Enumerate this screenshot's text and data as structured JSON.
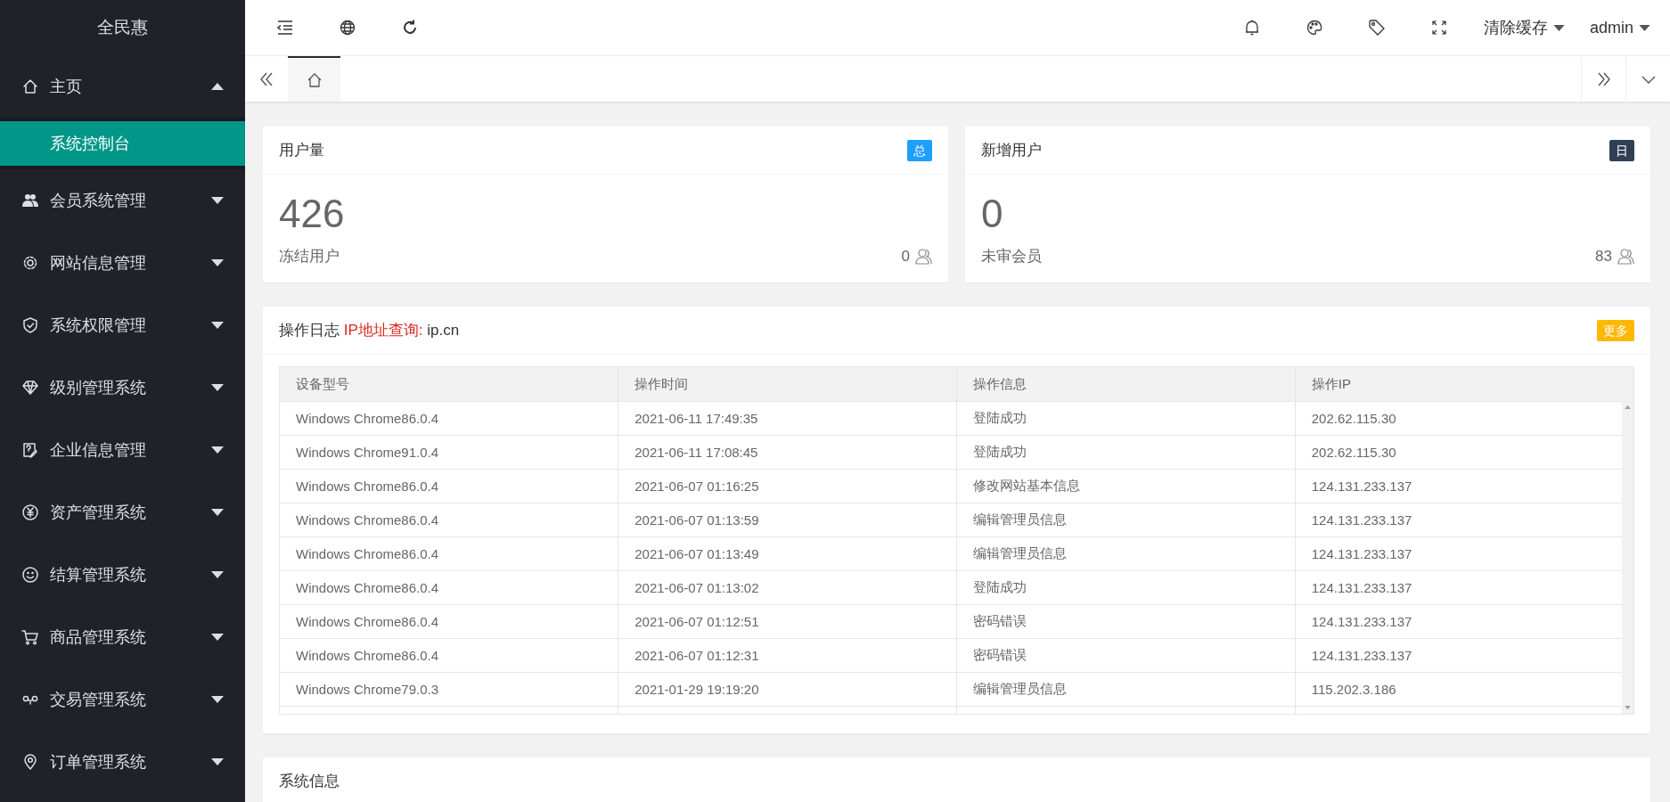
{
  "sidebar": {
    "logo": "全民惠",
    "items": [
      {
        "label": "主页",
        "expanded": true,
        "children": [
          {
            "label": "系统控制台",
            "selected": true
          }
        ]
      },
      {
        "label": "会员系统管理",
        "expanded": false
      },
      {
        "label": "网站信息管理",
        "expanded": false
      },
      {
        "label": "系统权限管理",
        "expanded": false
      },
      {
        "label": "级别管理系统",
        "expanded": false
      },
      {
        "label": "企业信息管理",
        "expanded": false
      },
      {
        "label": "资产管理系统",
        "expanded": false
      },
      {
        "label": "结算管理系统",
        "expanded": false
      },
      {
        "label": "商品管理系统",
        "expanded": false
      },
      {
        "label": "交易管理系统",
        "expanded": false
      },
      {
        "label": "订单管理系统",
        "expanded": false
      }
    ]
  },
  "header": {
    "menus": [
      {
        "label": "清除缓存"
      },
      {
        "label": "admin"
      }
    ]
  },
  "tabs": [
    {
      "selected": true
    }
  ],
  "stat_cards": [
    {
      "title": "用户量",
      "badge": "总",
      "color": "#1e9fff",
      "value": "426",
      "caption": "冻结用户",
      "count": "0"
    },
    {
      "title": "新增用户",
      "badge": "日",
      "color": "#2f4056",
      "value": "0",
      "caption": "未审会员",
      "count": "83"
    }
  ],
  "log_card": {
    "title": "操作日志",
    "link": "IP地址查询:",
    "link_value": "ip.cn",
    "badge": "更多",
    "table": {
      "columns": [
        "设备型号",
        "操作时间",
        "操作信息",
        "操作IP"
      ],
      "rows": [
        [
          "Windows Chrome86.0.4",
          "2021-06-11 17:49:35",
          "登陆成功",
          "202.62.115.30"
        ],
        [
          "Windows Chrome91.0.4",
          "2021-06-11 17:08:45",
          "登陆成功",
          "202.62.115.30"
        ],
        [
          "Windows Chrome86.0.4",
          "2021-06-07 01:16:25",
          "修改网站基本信息",
          "124.131.233.137"
        ],
        [
          "Windows Chrome86.0.4",
          "2021-06-07 01:13:59",
          "编辑管理员信息",
          "124.131.233.137"
        ],
        [
          "Windows Chrome86.0.4",
          "2021-06-07 01:13:49",
          "编辑管理员信息",
          "124.131.233.137"
        ],
        [
          "Windows Chrome86.0.4",
          "2021-06-07 01:13:02",
          "登陆成功",
          "124.131.233.137"
        ],
        [
          "Windows Chrome86.0.4",
          "2021-06-07 01:12:51",
          "密码错误",
          "124.131.233.137"
        ],
        [
          "Windows Chrome86.0.4",
          "2021-06-07 01:12:31",
          "密码错误",
          "124.131.233.137"
        ],
        [
          "Windows Chrome79.0.3",
          "2021-01-29 19:19:20",
          "编辑管理员信息",
          "115.202.3.186"
        ]
      ]
    }
  },
  "info_card": {
    "title": "系统信息"
  }
}
